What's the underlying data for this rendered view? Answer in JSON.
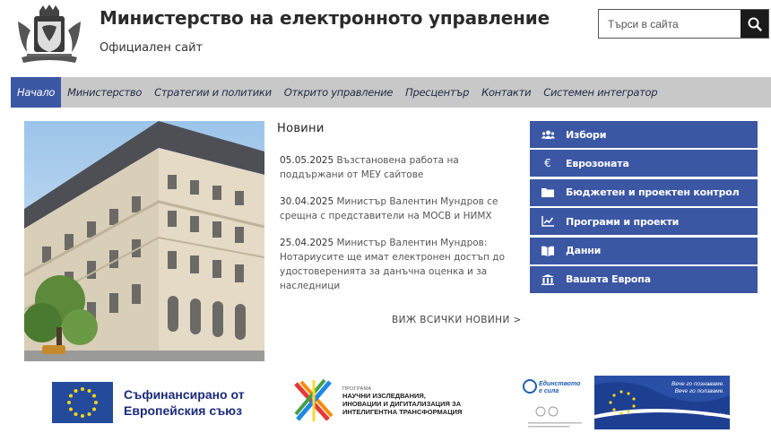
{
  "header": {
    "title": "Министерство на електронното управление",
    "subtitle": "Официален сайт",
    "search_placeholder": "Търси в сайта"
  },
  "nav": {
    "items": [
      {
        "label": "Начало",
        "active": true
      },
      {
        "label": "Министерство"
      },
      {
        "label": "Стратегии и политики"
      },
      {
        "label": "Открито управление"
      },
      {
        "label": "Пресцентър"
      },
      {
        "label": "Контакти"
      },
      {
        "label": "Системен интегратор"
      }
    ]
  },
  "news": {
    "title": "Новини",
    "items": [
      {
        "date": "05.05.2025",
        "text": "Възстановена работа на поддържани от МЕУ сайтове"
      },
      {
        "date": "30.04.2025",
        "text": "Министър Валентин Мундров се срещна с представители на МОСВ и НИМХ"
      },
      {
        "date": "25.04.2025",
        "text": "Министър Валентин Мундров: Нотариусите ще имат електронен достъп до удостоверенията за данъчна оценка и за наследници"
      }
    ],
    "all_link": "ВИЖ ВСИЧКИ НОВИНИ >"
  },
  "quicklinks": [
    {
      "label": "Избори",
      "icon": "users-icon"
    },
    {
      "label": "Еврозоната",
      "icon": "euro-icon"
    },
    {
      "label": "Бюджетен и проектен контрол",
      "icon": "folder-icon"
    },
    {
      "label": "Програми и проекти",
      "icon": "chart-icon"
    },
    {
      "label": "Данни",
      "icon": "book-icon"
    },
    {
      "label": "Вашата Европа",
      "icon": "institution-icon"
    }
  ],
  "footer": {
    "eu_line1": "Съфинансирано от",
    "eu_line2": "Европейския съюз",
    "program_small": "ПРОГРАМА",
    "program_line1": "НАУЧНИ ИЗСЛЕДВАНИЯ,",
    "program_line2": "ИНОВАЦИИ И ДИГИТАЛИЗАЦИЯ ЗА",
    "program_line3": "ИНТЕЛИГЕНТНА ТРАНСФОРМАЦИЯ",
    "unity_brand_1": "Единството",
    "unity_brand_2": "е сила",
    "unity_slogan_1": "Вече го познаваме.",
    "unity_slogan_2": "Вече го ползваме.",
    "unity_site": "eufunds.bg"
  },
  "colors": {
    "accent": "#3b57a4",
    "nav_bg": "#c8c8c8",
    "search_button": "#1a1a1a"
  }
}
